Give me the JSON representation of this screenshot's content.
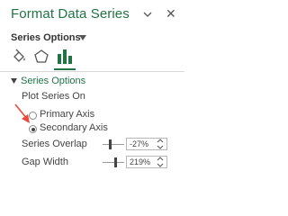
{
  "panel": {
    "title": "Format Data Series",
    "close_glyph": "✕",
    "series_options_menu": "Series Options",
    "tabs": [
      {
        "name": "fill-line-tab",
        "icon": "paint-bucket-icon"
      },
      {
        "name": "effects-tab",
        "icon": "pentagon-icon"
      },
      {
        "name": "series-options-tab",
        "icon": "bar-chart-icon",
        "selected": true
      }
    ]
  },
  "series_options": {
    "section_title": "Series Options",
    "plot_series_on_label": "Plot Series On",
    "primary_axis_label": "Primary Axis",
    "secondary_axis_label": "Secondary Axis",
    "selected_axis": "Secondary Axis",
    "series_overlap_label": "Series Overlap",
    "series_overlap_value": "-27%",
    "gap_width_label": "Gap Width",
    "gap_width_value": "219%"
  },
  "colors": {
    "accent": "#217346",
    "arrow": "#e74c3c"
  }
}
